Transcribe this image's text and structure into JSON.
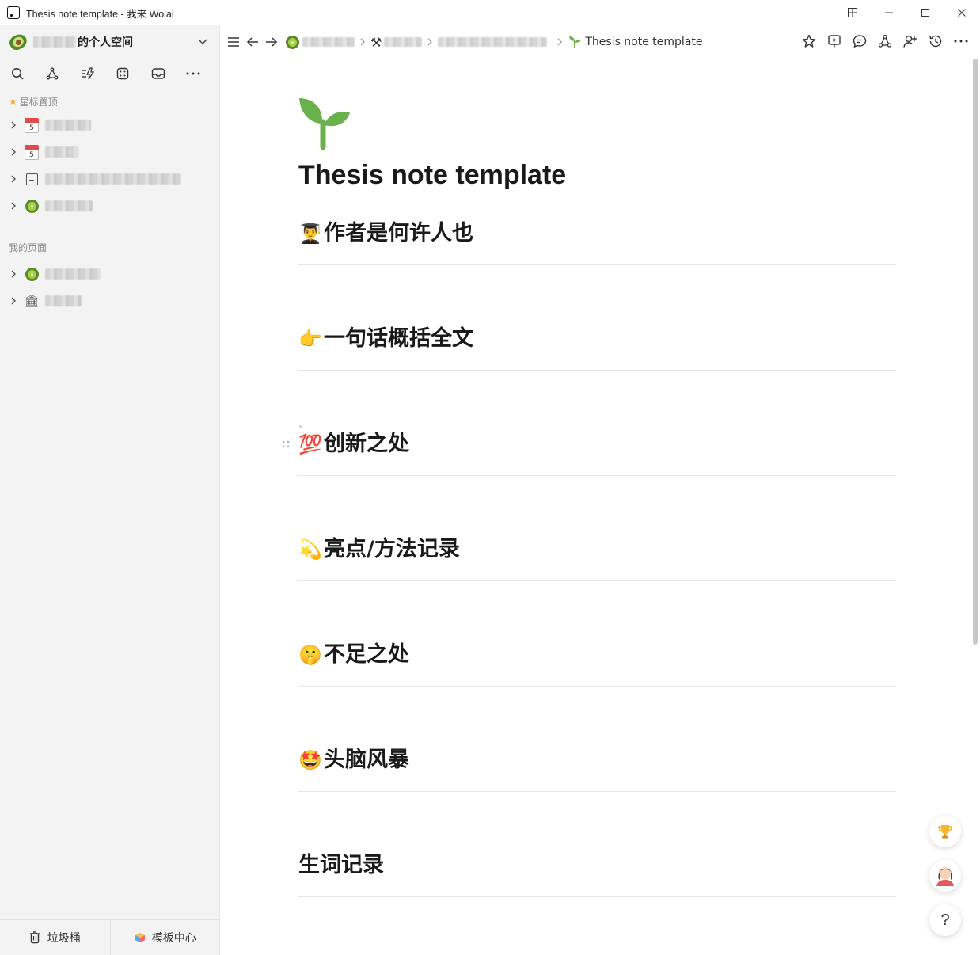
{
  "window": {
    "title": "Thesis note template - 我来 Wolai",
    "controls": [
      "grid",
      "minimize",
      "maximize",
      "close"
    ]
  },
  "sidebar": {
    "workspace_suffix": "的个人空间",
    "tools": [
      "search-icon",
      "graph-icon",
      "flash-icon",
      "template-icon",
      "inbox-icon",
      "more-icon"
    ],
    "starred_label": "星标置顶",
    "starred_items": [
      {
        "icon": "calendar-icon",
        "cal_day": "5"
      },
      {
        "icon": "calendar-icon",
        "cal_day": "5"
      },
      {
        "icon": "document-icon"
      },
      {
        "icon": "kiwi-icon"
      }
    ],
    "mypages_label": "我的页面",
    "my_pages": [
      {
        "icon": "kiwi-icon"
      },
      {
        "icon": "bank-icon",
        "glyph": "🏛"
      }
    ],
    "footer": {
      "trash_label": "垃圾桶",
      "templates_label": "模板中心"
    }
  },
  "topnav": {
    "current_page": "Thesis note template",
    "right_tools": [
      "star-icon",
      "present-icon",
      "comment-icon",
      "graph-icon",
      "share-user-icon",
      "history-icon",
      "more-icon"
    ]
  },
  "page": {
    "emoji": "🌱",
    "title": "Thesis note template",
    "headings": [
      {
        "emoji": "👨‍🎓",
        "text": "作者是何许人也"
      },
      {
        "emoji": "👉",
        "text": "一句话概括全文"
      },
      {
        "emoji": "💯",
        "text": "创新之处"
      },
      {
        "emoji": "💫",
        "text": "亮点/方法记录"
      },
      {
        "emoji": "🤫",
        "text": "不足之处"
      },
      {
        "emoji": "🤩",
        "text": "头脑风暴"
      },
      {
        "emoji": "",
        "text": "生词记录"
      }
    ]
  },
  "floating": {
    "help_label": "?",
    "buttons": [
      "trophy-icon",
      "avatar",
      "help-icon"
    ]
  },
  "colors": {
    "sidebar_bg": "#f3f3f3",
    "star": "#f5a623",
    "sprout": "#6ab04c"
  }
}
